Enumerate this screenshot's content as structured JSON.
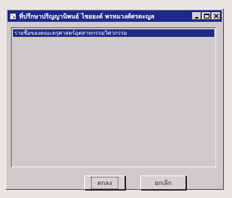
{
  "window": {
    "title": "ที่ปรึกษาปริญญานิพนธ์ ไชยยงค์ พรหมวงศ์ศรตะญล",
    "controls": [
      "minimize",
      "maximize",
      "close"
    ]
  },
  "list": {
    "items": [
      {
        "label": "รายชื่อของคณะครุศาสตร์อุตสาหกรรมวิศวกรรม",
        "selected": true
      }
    ]
  },
  "buttons": {
    "ok_label": "ตกลง",
    "cancel_label": "ยกเลิก"
  },
  "colors": {
    "title_bar": "#1e2a8a",
    "window_face": "#cfcaca",
    "selection": "#1e2a8a"
  }
}
